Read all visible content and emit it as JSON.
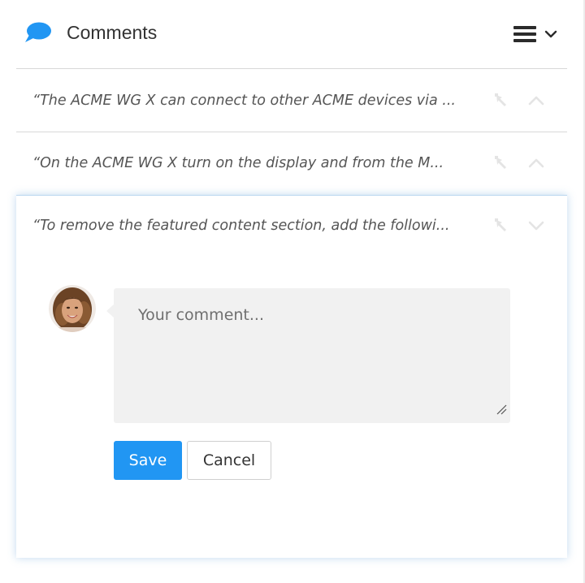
{
  "header": {
    "title": "Comments",
    "icons": {
      "chat": "chat-bubble-icon",
      "menu": "hamburger-icon",
      "dropdown": "chevron-down-icon"
    },
    "accent_color": "#2196f3"
  },
  "comments": [
    {
      "quote": "“The ACME WG X can connect to other ACME devices via ...",
      "state": "collapsed"
    },
    {
      "quote": "“On the ACME WG X turn on the display and from the M...",
      "state": "collapsed"
    },
    {
      "quote": "“To remove the featured content section, add the followi...",
      "state": "expanded"
    }
  ],
  "reply": {
    "placeholder": "Your comment...",
    "value": "",
    "save_label": "Save",
    "cancel_label": "Cancel"
  },
  "colors": {
    "save_button": "#2196f3",
    "textarea_bg": "#f1f1f1",
    "icon_muted": "#e4e4e4"
  }
}
